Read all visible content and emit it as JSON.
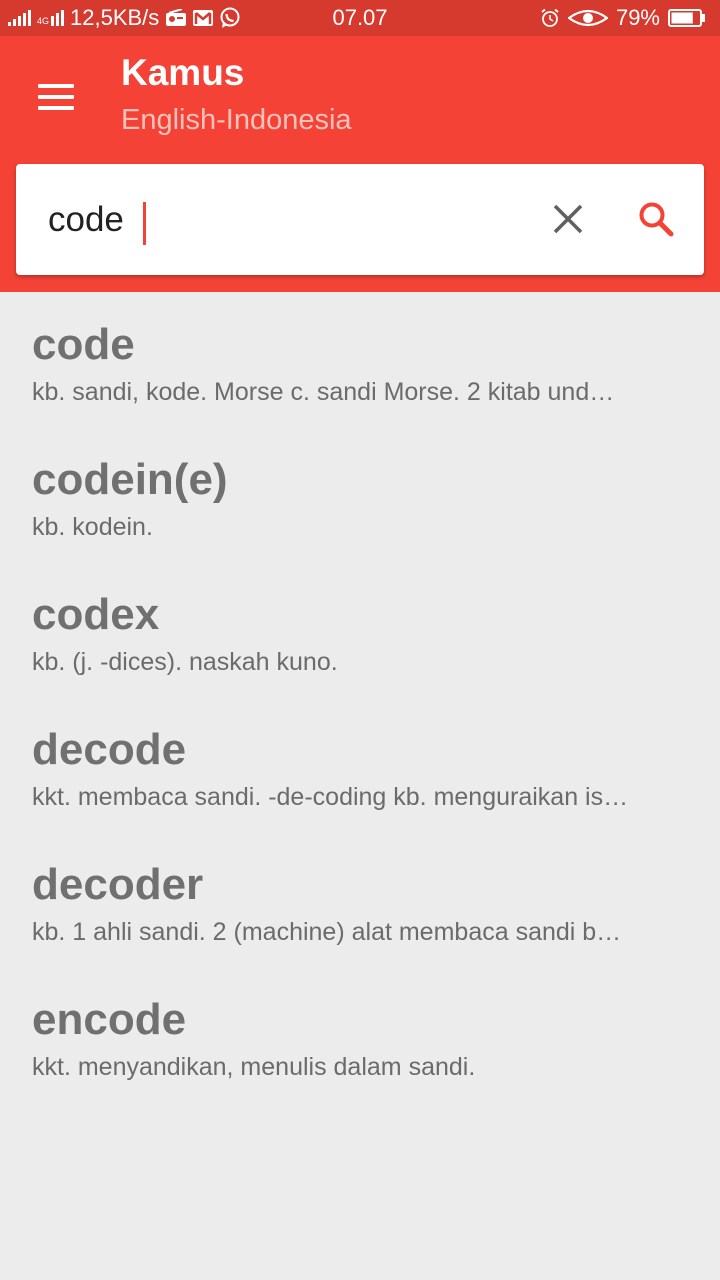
{
  "status_bar": {
    "network_type": "4G",
    "speed": "12,5KB/s",
    "time": "07.07",
    "battery_percent": "79%",
    "icons": [
      "signal-icon",
      "signal-4g-icon",
      "radio-icon",
      "gmail-icon",
      "whatsapp-icon",
      "alarm-icon",
      "eye-icon",
      "battery-icon"
    ],
    "battery_level": 0.79
  },
  "app_bar": {
    "title": "Kamus",
    "subtitle": "English-Indonesia",
    "color": "#f44336",
    "status_color": "#d63a2f"
  },
  "search": {
    "value": "code",
    "accent": "#f44336"
  },
  "results": [
    {
      "word": "code",
      "definition": "kb. sandi, kode.  Morse c. sandi Morse. 2 kitab und…"
    },
    {
      "word": "codein(e)",
      "definition": "kb. kodein."
    },
    {
      "word": "codex",
      "definition": "kb. (j. -dices). naskah kuno."
    },
    {
      "word": "decode",
      "definition": "kkt. membaca sandi. -de-coding kb. menguraikan is…"
    },
    {
      "word": "decoder",
      "definition": "kb. 1 ahli sandi. 2 (machine) alat membaca sandi b…"
    },
    {
      "word": "encode",
      "definition": "kkt. menyandikan, menulis dalam sandi."
    }
  ]
}
